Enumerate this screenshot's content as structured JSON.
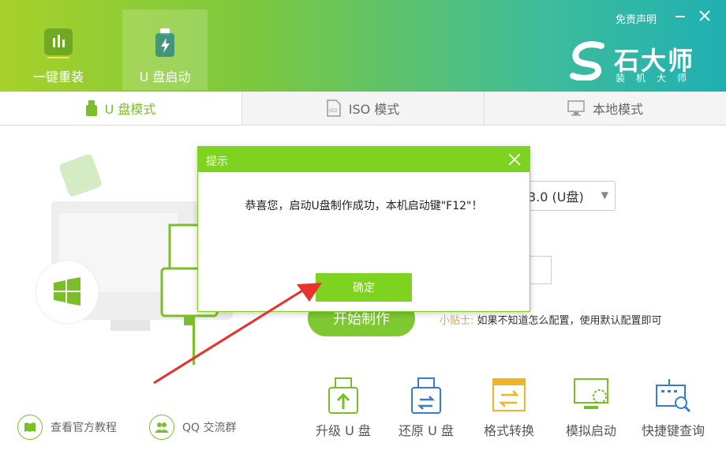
{
  "header": {
    "nav": [
      {
        "label": "一键重装",
        "icon": "bar-chart-icon"
      },
      {
        "label": "U 盘启动",
        "icon": "usb-drive-icon"
      }
    ],
    "disclaimer": "免责声明",
    "brand": "石大师",
    "brand_sub": "装机大师"
  },
  "modes": [
    {
      "label": "U 盘模式",
      "icon": "usb-icon"
    },
    {
      "label": "ISO 模式",
      "icon": "iso-file-icon"
    },
    {
      "label": "本地模式",
      "icon": "monitor-icon"
    }
  ],
  "main": {
    "device_select": "3.0 (U盘)",
    "start_button": "开始制作",
    "tip_key": "小贴士:",
    "tip_text": "如果不知道怎么配置，使用默认配置即可"
  },
  "bottom_links": [
    {
      "label": "查看官方教程",
      "icon": "book-icon"
    },
    {
      "label": "QQ 交流群",
      "icon": "group-icon"
    }
  ],
  "tools": [
    {
      "label": "升级 U 盘",
      "icon": "usb-upgrade-icon"
    },
    {
      "label": "还原 U 盘",
      "icon": "usb-restore-icon"
    },
    {
      "label": "格式转换",
      "icon": "format-convert-icon"
    },
    {
      "label": "模拟启动",
      "icon": "simulate-boot-icon"
    },
    {
      "label": "快捷键查询",
      "icon": "keyboard-search-icon"
    }
  ],
  "dialog": {
    "title": "提示",
    "message": "恭喜您，启动U盘制作成功，本机启动键\"F12\"！",
    "ok": "确定"
  },
  "colors": {
    "accent": "#7ed321",
    "header_start": "#a6d12a",
    "header_end": "#1fb0b2",
    "arrow": "#e8322b"
  }
}
